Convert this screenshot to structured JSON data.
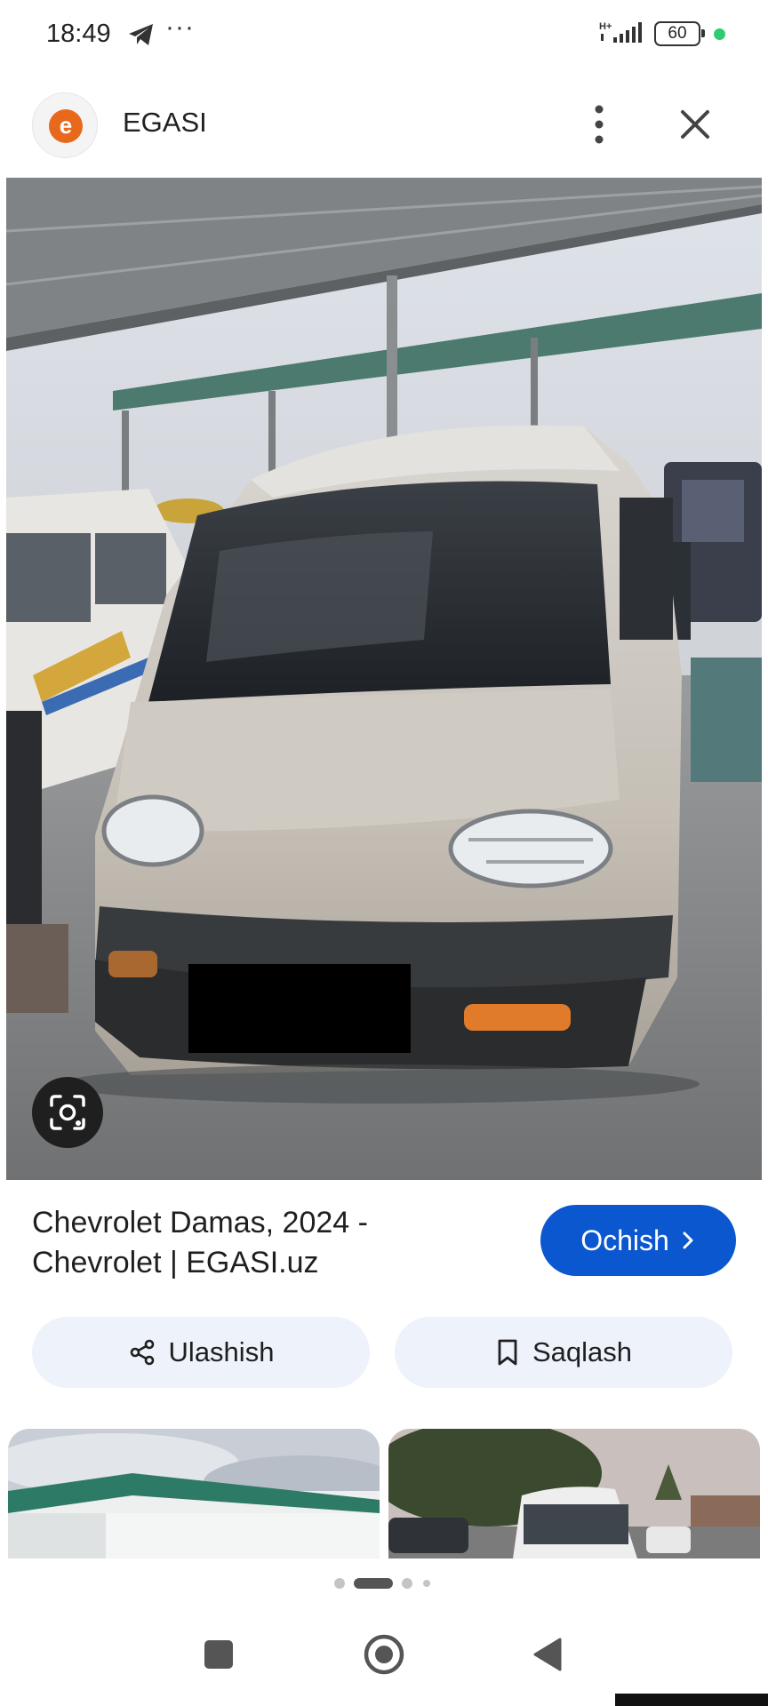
{
  "status_bar": {
    "time": "18:49",
    "dots": "···",
    "network_label": "H+",
    "battery_level": "60",
    "icons": [
      "telegram-icon",
      "signal-icon",
      "battery-icon",
      "active-dot-icon"
    ]
  },
  "header": {
    "site_name": "EGASI",
    "logo_letter": "e",
    "accent_color": "#e8681c",
    "icons": [
      "more-vert-icon",
      "close-icon"
    ]
  },
  "result": {
    "title_line1": "Chevrolet Damas, 2024 -",
    "title_line2": "Chevrolet | EGASI.uz",
    "open_label": "Ochish",
    "open_color": "#0b57d0"
  },
  "actions": {
    "share_label": "Ulashish",
    "save_label": "Saqlash"
  },
  "pagination": {
    "pages": 4,
    "active_index": 1
  },
  "navigation": {
    "icons": [
      "recent-apps-icon",
      "home-icon",
      "back-icon"
    ]
  }
}
